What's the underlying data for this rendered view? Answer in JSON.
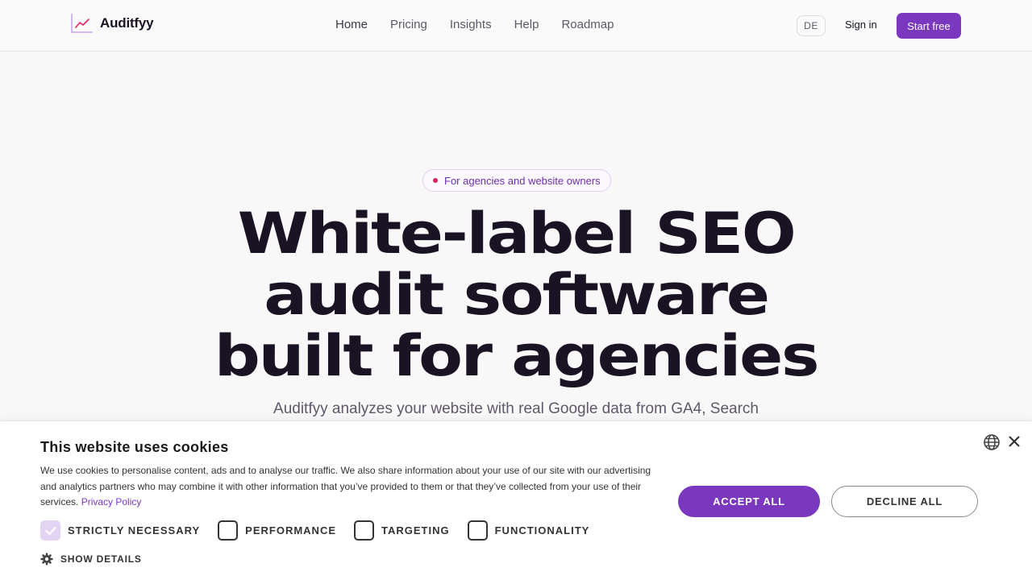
{
  "header": {
    "brand": "Auditfyy",
    "nav": [
      {
        "label": "Home",
        "active": true
      },
      {
        "label": "Pricing"
      },
      {
        "label": "Insights"
      },
      {
        "label": "Help"
      },
      {
        "label": "Roadmap"
      }
    ],
    "language": "DE",
    "sign_in": "Sign in",
    "start_free": "Start free",
    "accent_color": "#7a38bf"
  },
  "hero": {
    "badge": "For agencies and website owners",
    "title_lines": [
      "White-label SEO",
      "audit software",
      "built for agencies"
    ],
    "subtitle": "Auditfyy analyzes your website with real Google data from GA4, Search"
  },
  "cookie_banner": {
    "title": "This website uses cookies",
    "body": "We use cookies to personalise content, ads and to analyse our traffic. We also share information about your use of our site with our advertising and analytics partners who may combine it with other information that you’ve provided to them or that they’ve collected from your use of their services.",
    "privacy_link": "Privacy Policy",
    "accept": "ACCEPT ALL",
    "decline": "DECLINE ALL",
    "categories": [
      {
        "label": "STRICTLY NECESSARY",
        "checked": true
      },
      {
        "label": "PERFORMANCE",
        "checked": false
      },
      {
        "label": "TARGETING",
        "checked": false
      },
      {
        "label": "FUNCTIONALITY",
        "checked": false
      }
    ],
    "show_details": "SHOW DETAILS",
    "icons": {
      "language": "globe-icon",
      "close": "close-icon",
      "details": "gear-icon"
    }
  }
}
